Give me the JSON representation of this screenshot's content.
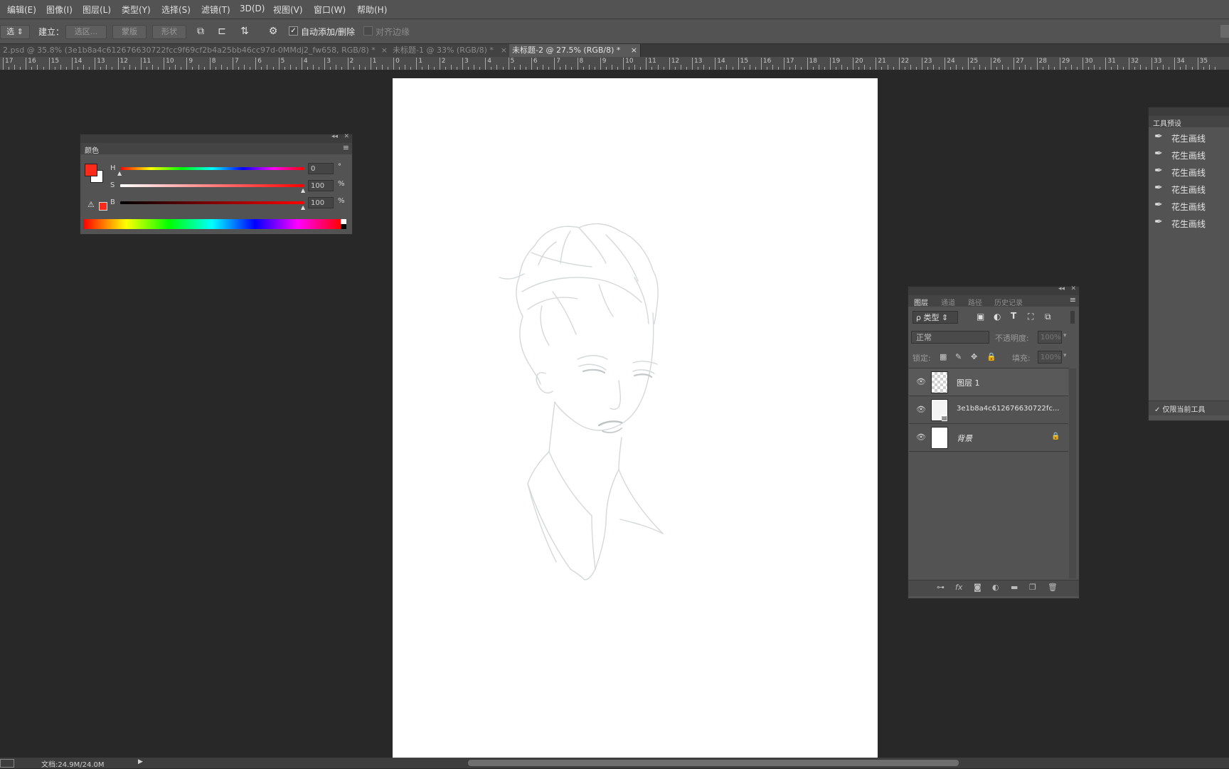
{
  "menu": [
    "编辑(E)",
    "图像(I)",
    "图层(L)",
    "类型(Y)",
    "选择(S)",
    "滤镜(T)",
    "3D(D)",
    "视图(V)",
    "窗口(W)",
    "帮助(H)"
  ],
  "options": {
    "mode_value": "选",
    "create_label": "建立：",
    "selection_btn": "选区...",
    "mask_btn": "蒙版",
    "shape_btn": "形状",
    "auto_add_label": "自动添加/删除",
    "align_edges_label": "对齐边缘"
  },
  "tabs": [
    {
      "label": "2.psd @ 35.8% (3e1b8a4c612676630722fcc9f69cf2b4a25bb46cc97d-0MMdj2_fw658, RGB/8) *",
      "close": "×"
    },
    {
      "label": "未标题-1 @ 33% (RGB/8) *",
      "close": "×"
    },
    {
      "label": "未标题-2 @ 27.5% (RGB/8) *",
      "close": "×"
    }
  ],
  "ruler_labels": [
    "17",
    "16",
    "15",
    "14",
    "13",
    "12",
    "11",
    "10",
    "9",
    "8",
    "7",
    "6",
    "5",
    "4",
    "3",
    "2",
    "1",
    "0",
    "1",
    "2",
    "3",
    "4",
    "5",
    "6",
    "7",
    "8",
    "9",
    "10",
    "11",
    "12",
    "13",
    "14",
    "15",
    "16",
    "17",
    "18",
    "19",
    "20",
    "21",
    "22",
    "23",
    "24",
    "25",
    "26",
    "27",
    "28",
    "29",
    "30",
    "31",
    "32",
    "33",
    "34",
    "35"
  ],
  "color_panel": {
    "title": "颜色",
    "h_label": "H",
    "s_label": "S",
    "b_label": "B",
    "h_value": "0",
    "s_value": "100",
    "b_value": "100",
    "h_unit": "°",
    "s_unit": "%",
    "b_unit": "%",
    "h_fraction": 0.0,
    "s_fraction": 1.0,
    "b_fraction": 1.0,
    "foreground": "#ff2a1a",
    "background": "#ffffff",
    "warning_glyph": "⚠"
  },
  "layers_panel": {
    "tabs": [
      "图层",
      "通道",
      "路径",
      "历史记录"
    ],
    "filter_label": "ρ 类型",
    "blend_mode": "正常",
    "opacity_label": "不透明度:",
    "opacity_value": "100%",
    "lock_label": "锁定:",
    "fill_label": "填充:",
    "fill_value": "100%",
    "layers": [
      {
        "name": "图层 1",
        "visible": true,
        "eye": "👁"
      },
      {
        "name": "3e1b8a4c612676630722fc...",
        "visible": true,
        "eye": "👁"
      },
      {
        "name": "背景",
        "visible": true,
        "eye": "👁",
        "lock": "🔒"
      }
    ],
    "footer_icons": [
      "link-icon",
      "fx-icon",
      "mask-icon",
      "adjustment-icon",
      "folder-icon",
      "new-layer-icon",
      "trash-icon"
    ]
  },
  "tool_presets": {
    "title": "工具预设",
    "items": [
      "花生画线",
      "花生画线",
      "花生画线",
      "花生画线",
      "花生画线",
      "花生画线"
    ],
    "current_only_label": "✓ 仅限当前工具"
  },
  "status": {
    "doc_label": "文档:24.9M/24.0M",
    "arrow": "▶"
  },
  "colors": {
    "menu_bg": "#535353",
    "canvas_bg": "#282828",
    "sketch_line": "#cfd3d4"
  }
}
